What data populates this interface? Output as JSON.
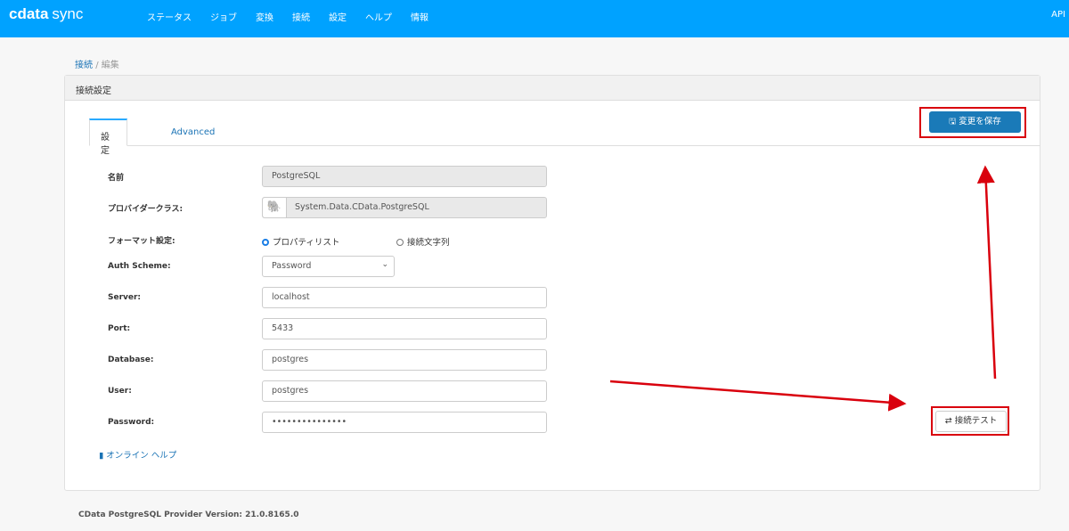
{
  "nav": {
    "logo_main": "cdata",
    "logo_sub": "sync",
    "items": [
      "ステータス",
      "ジョブ",
      "変換",
      "接続",
      "設定",
      "ヘルプ",
      "情報"
    ],
    "api": "API"
  },
  "breadcrumb": {
    "parent": "接続",
    "sep": "/",
    "current": "編集"
  },
  "card": {
    "title": "接続設定",
    "tabs": [
      "設定",
      "Advanced"
    ],
    "save_label": "変更を保存",
    "test_label": "接続テスト",
    "help_label": "オンライン ヘルプ"
  },
  "form": {
    "name": {
      "label": "名前",
      "value": "PostgreSQL"
    },
    "provider": {
      "label": "プロバイダークラス:",
      "value": "System.Data.CData.PostgreSQL"
    },
    "format": {
      "label": "フォーマット設定:",
      "opt1": "プロパティリスト",
      "opt2": "接続文字列",
      "selected": "プロパティリスト"
    },
    "auth": {
      "label": "Auth Scheme:",
      "value": "Password"
    },
    "server": {
      "label": "Server:",
      "value": "localhost"
    },
    "port": {
      "label": "Port:",
      "value": "5433"
    },
    "database": {
      "label": "Database:",
      "value": "postgres"
    },
    "user": {
      "label": "User:",
      "value": "postgres"
    },
    "password": {
      "label": "Password:",
      "value": "•••••••••••••••"
    }
  },
  "footer": "CData PostgreSQL Provider Version: 21.0.8165.0",
  "colors": {
    "nav": "#00a2ff",
    "primary": "#1a7ab8",
    "highlight": "#d9000d"
  }
}
